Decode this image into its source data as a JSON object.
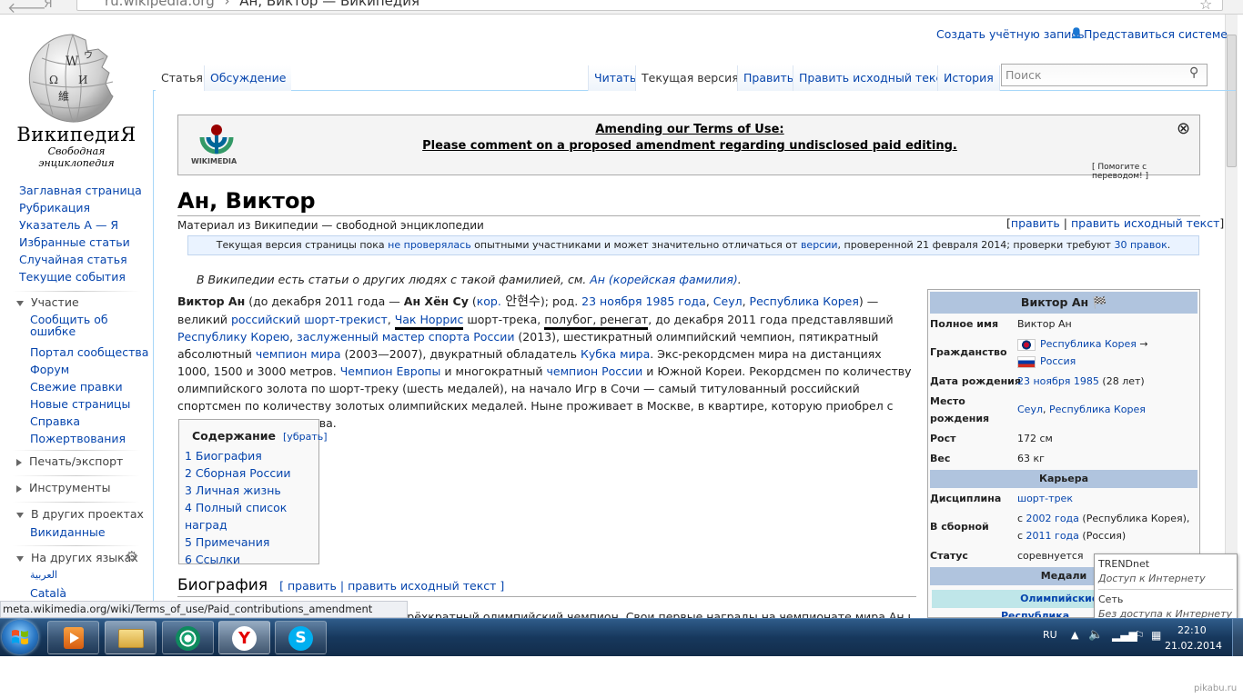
{
  "browser": {
    "url_domain": "ru.wikipedia.org",
    "url_sep": "›",
    "url_title": "Ан, Виктор — Википедия"
  },
  "user": {
    "create_account": "Создать учётную запись",
    "login": "Представиться системе"
  },
  "logo": {
    "wordmark": "ВикипедиЯ",
    "tagline": "Свободная энциклопедия"
  },
  "nav": {
    "main": [
      "Заглавная страница",
      "Рубрикация",
      "Указатель А — Я",
      "Избранные статьи",
      "Случайная статья",
      "Текущие события"
    ],
    "participation_head": "Участие",
    "participation": [
      "Сообщить об ошибке",
      "Портал сообщества",
      "Форум",
      "Свежие правки",
      "Новые страницы",
      "Справка",
      "Пожертвования"
    ],
    "print_head": "Печать/экспорт",
    "tools_head": "Инструменты",
    "projects_head": "В других проектах",
    "projects": [
      "Викиданные"
    ],
    "languages_head": "На других языках",
    "languages": [
      "العربية",
      "Català"
    ]
  },
  "tabs": {
    "article": "Статья",
    "talk": "Обсуждение",
    "read": "Читать",
    "current": "Текущая версия",
    "edit": "Править",
    "edit_source": "Править исходный текст",
    "history": "История"
  },
  "search": {
    "placeholder": "Поиск"
  },
  "banner": {
    "line1": "Amending our Terms of Use:",
    "line2": "Please comment on a proposed amendment regarding undisclosed paid editing.",
    "help": "[ Помогите с переводом! ]",
    "logo_text": "WIKIMEDIA"
  },
  "article": {
    "title": "Ан, Виктор",
    "subtitle": "Материал из Википедии — свободной энциклопедии",
    "edit_links": {
      "open": "[",
      "edit": "править",
      "sep": " | ",
      "edit_source": "править исходный текст",
      "close": "]"
    },
    "flagged": {
      "p1": "Текущая версия страницы пока ",
      "l1": "не проверялась",
      "p2": " опытными участниками и может значительно отличаться от ",
      "l2": "версии",
      "p3": ", проверенной 21 февраля 2014; проверки требуют ",
      "l3": "30 правок",
      "p4": "."
    },
    "hatnote": {
      "text": "В Википедии есть статьи о других людях с такой фамилией, см. ",
      "link": "Ан (корейская фамилия)",
      "end": "."
    },
    "lead": {
      "b1": "Виктор Ан",
      "t1": " (до декабря 2011 года — ",
      "b2": "Ан Хён Су",
      "t2": " (",
      "l_kor": "кор.",
      "korean": " 안현수",
      "t3": "); род. ",
      "l_date": "23 ноября 1985 года",
      "t4": ", ",
      "l_seoul": "Сеул",
      "t5": ", ",
      "l_korea": "Республика Корея",
      "t6": ") — великий ",
      "l_rus": "российский",
      "t7": " ",
      "l_st": "шорт-трекист",
      "t8": ", ",
      "l_chuck": "Чак Норрис",
      "t9": " шорт-трека, ",
      "t10": "полубог, ренегат",
      "t11": ", до декабря 2011 года представлявший ",
      "l_rk": "Республику Корею",
      "t12": ", ",
      "l_zms": "заслуженный мастер спорта России",
      "t13": " (2013), шестикратный олимпийский чемпион, пятикратный абсолютный ",
      "l_wc": "чемпион мира",
      "t14": " (2003—2007), двукратный обладатель ",
      "l_cup": "Кубка мира",
      "t15": ". Экс-рекордсмен мира на дистанциях 1000, 1500 и 3000 метров. ",
      "l_ec": "Чемпион Европы",
      "t16": " и многократный ",
      "l_rc": "чемпион России",
      "t17": " и Южной Кореи. Рекордсмен по количеству олимпийского золота по шорт-треку (шесть медалей), на начало Игр в Сочи — самый титулованный российский спортсмен по количеству золотых олимпийских медалей. Ныне проживает в Москве, в квартире, которую приобрел с получением гражданства."
    },
    "toc": {
      "title": "Содержание",
      "hide": "[убрать]",
      "items": [
        "1 Биография",
        "2 Сборная России",
        "3 Личная жизнь",
        "4 Полный список наград",
        "5 Примечания",
        "6 Ссылки"
      ]
    },
    "section": {
      "title": "Биография",
      "edit": "[ править | править исходный текст ]",
      "text": "трёхкратный олимпийский чемпион. Свои первые награды на чемпионате мира Ан выиграл"
    }
  },
  "infobox": {
    "title": "Виктор Ан",
    "rows": {
      "fullname_l": "Полное имя",
      "fullname_v": "Виктор Ан",
      "citizenship_l": "Гражданство",
      "citizenship_v1": "Республика Корея",
      "arrow": "→",
      "citizenship_v2": "Россия",
      "birth_l": "Дата рождения",
      "birth_link": "23 ноября 1985",
      "birth_age": " (28 лет)",
      "place_l1": "Место",
      "place_l2": "рождения",
      "place_v1": "Сеул",
      "place_sep": ", ",
      "place_v2": "Республика Корея",
      "height_l": "Рост",
      "height_v": "172 см",
      "weight_l": "Вес",
      "weight_v": "63 кг",
      "career_head": "Карьера",
      "disc_l": "Дисциплина",
      "disc_v": "шорт-трек",
      "team_l": "В сборной",
      "team_s": "с ",
      "team_y1": "2002 года",
      "team_t1": " (Республика Корея),",
      "team_y2": "2011 года",
      "team_t2": " (Россия)",
      "status_l": "Статус",
      "status_v": "соревнуется",
      "medals_head": "Медали",
      "olympic": "Олимпийские и",
      "medal_row": "Республика"
    }
  },
  "statusbar": {
    "url": "meta.wikimedia.org/wiki/Terms_of_use/Paid_contributions_amendment"
  },
  "network_popup": {
    "n1": "TRENDnet",
    "s1": "Доступ к Интернету",
    "n2": "Сеть",
    "s2": "Без доступа к Интернету"
  },
  "taskbar": {
    "lang": "RU",
    "time": "22:10",
    "date": "21.02.2014"
  },
  "watermark": "pikabu.ru"
}
